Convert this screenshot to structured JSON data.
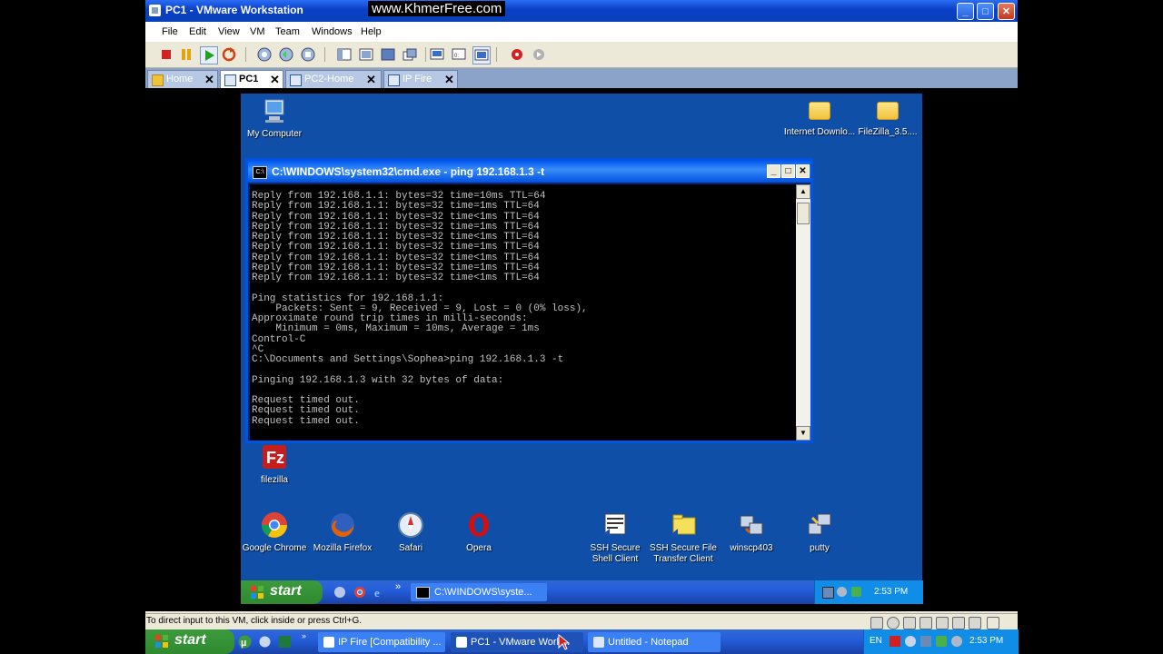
{
  "host": {
    "window_title": "PC1 - VMware Workstation",
    "watermark": "www.KhmerFree.com",
    "title_buttons": {
      "minimize": "_",
      "maximize": "□",
      "close": "✕"
    },
    "menu": [
      "File",
      "Edit",
      "View",
      "VM",
      "Team",
      "Windows",
      "Help"
    ],
    "tabs": [
      {
        "label": "Home",
        "active": false
      },
      {
        "label": "PC1",
        "active": true
      },
      {
        "label": "PC2-Home",
        "active": false
      },
      {
        "label": "IP Fire",
        "active": false
      }
    ],
    "tab_close": "✕",
    "status_text": "To direct input to this VM, click inside or press Ctrl+G.",
    "taskbar": {
      "start_label": "start",
      "buttons": [
        {
          "label": "IP Fire [Compatibility ..."
        },
        {
          "label": "PC1 - VMware Work..."
        },
        {
          "label": "Untitled - Notepad"
        }
      ],
      "tray_lang": "EN",
      "clock": "2:53 PM"
    }
  },
  "guest": {
    "icons": {
      "my_computer": "My Computer",
      "internet_download": "Internet Downlo...",
      "filezilla_setup": "FileZilla_3.5....",
      "filezilla": "filezilla",
      "chrome": "Google Chrome",
      "firefox": "Mozilla Firefox",
      "safari": "Safari",
      "opera": "Opera",
      "ssh_shell": "SSH Secure Shell Client",
      "ssh_file": "SSH Secure File Transfer Client",
      "winscp": "winscp403",
      "putty": "putty"
    },
    "cmd": {
      "title": "C:\\WINDOWS\\system32\\cmd.exe - ping 192.168.1.3 -t",
      "icon_text": "C:\\",
      "buttons": {
        "minimize": "_",
        "maximize": "□",
        "close": "✕"
      },
      "output": "Reply from 192.168.1.1: bytes=32 time=10ms TTL=64\nReply from 192.168.1.1: bytes=32 time=1ms TTL=64\nReply from 192.168.1.1: bytes=32 time<1ms TTL=64\nReply from 192.168.1.1: bytes=32 time=1ms TTL=64\nReply from 192.168.1.1: bytes=32 time<1ms TTL=64\nReply from 192.168.1.1: bytes=32 time=1ms TTL=64\nReply from 192.168.1.1: bytes=32 time<1ms TTL=64\nReply from 192.168.1.1: bytes=32 time=1ms TTL=64\nReply from 192.168.1.1: bytes=32 time<1ms TTL=64\n\nPing statistics for 192.168.1.1:\n    Packets: Sent = 9, Received = 9, Lost = 0 (0% loss),\nApproximate round trip times in milli-seconds:\n    Minimum = 0ms, Maximum = 10ms, Average = 1ms\nControl-C\n^C\nC:\\Documents and Settings\\Sophea>ping 192.168.1.3 -t\n\nPinging 192.168.1.3 with 32 bytes of data:\n\nRequest timed out.\nRequest timed out.\nRequest timed out."
    },
    "taskbar": {
      "start_label": "start",
      "button_label": "C:\\WINDOWS\\syste...",
      "clock": "2:53 PM",
      "quicklaunch_more": "»"
    }
  }
}
